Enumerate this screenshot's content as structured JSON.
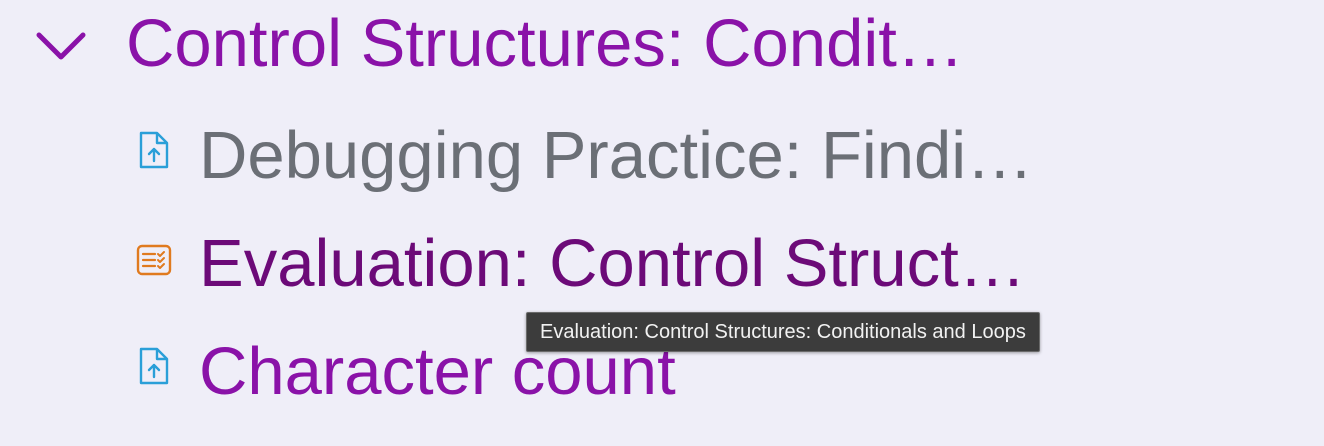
{
  "section": {
    "title": "Control Structures: Condit…",
    "expanded": true,
    "chevron_icon": "chevron-down-icon",
    "title_color": "#8a12a8"
  },
  "items": [
    {
      "label": "Debugging Practice: Findi…",
      "icon": "file-upload-icon",
      "icon_color": "#2a9fd8",
      "text_color": "#6b6f76"
    },
    {
      "label": "Evaluation: Control Struct…",
      "icon": "checklist-icon",
      "icon_color": "#e07a1f",
      "text_color": "#6c0a78"
    },
    {
      "label": "Character count",
      "icon": "file-upload-icon",
      "icon_color": "#2a9fd8",
      "text_color": "#8a12a8"
    }
  ],
  "tooltip": {
    "text": "Evaluation: Control Structures: Conditionals and Loops"
  }
}
